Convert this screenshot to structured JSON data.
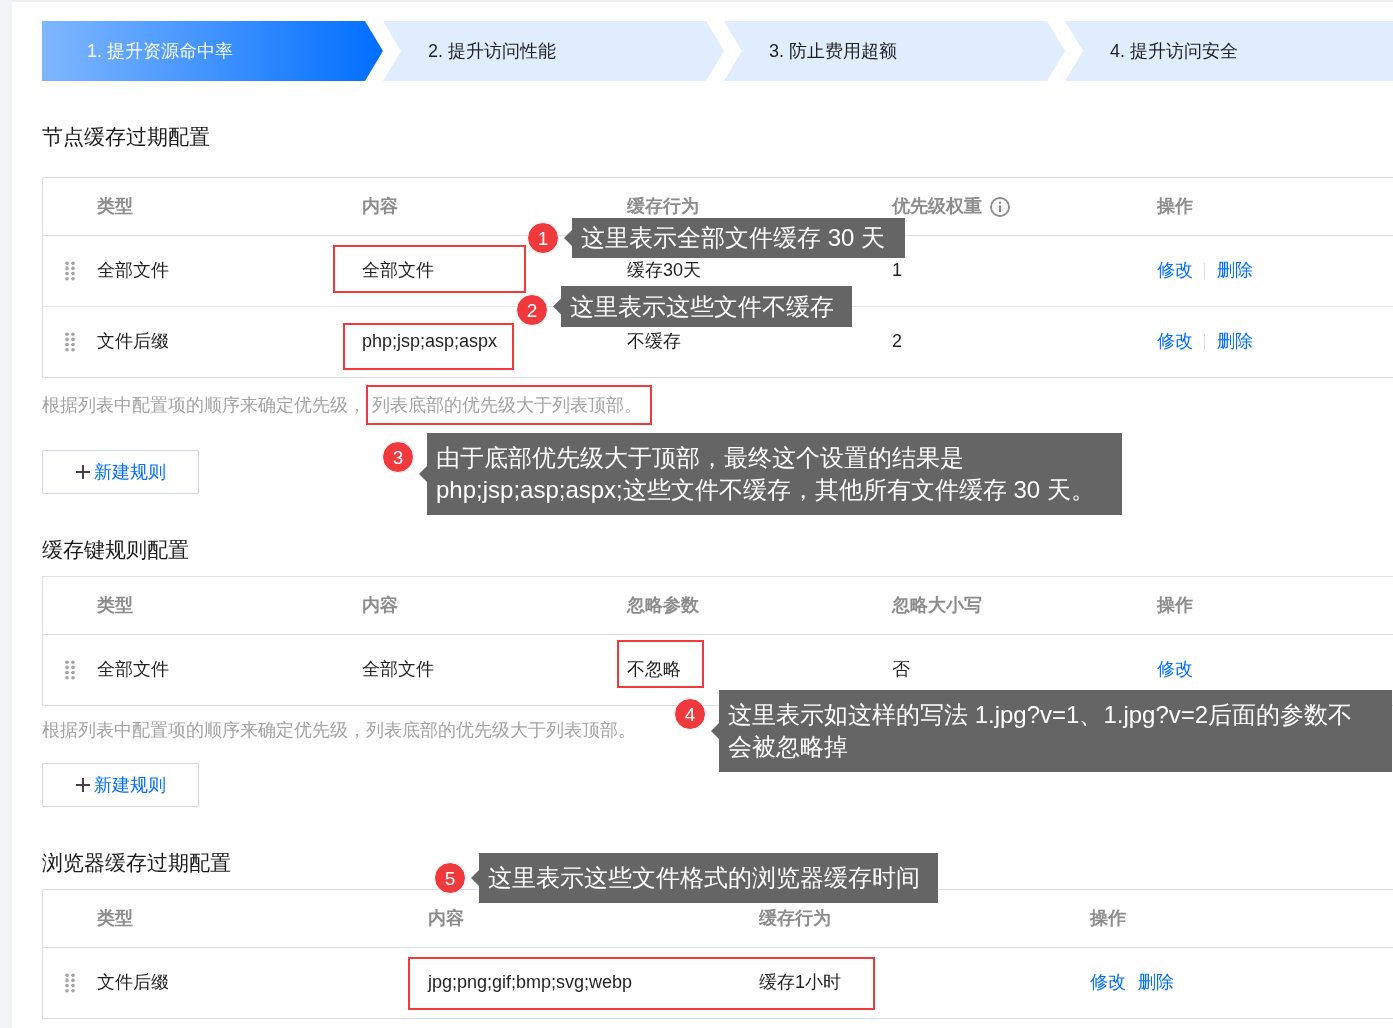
{
  "steps": [
    {
      "label": "1. 提升资源命中率",
      "selected": true
    },
    {
      "label": "2. 提升访问性能",
      "selected": false
    },
    {
      "label": "3. 防止费用超额",
      "selected": false
    },
    {
      "label": "4. 提升访问安全",
      "selected": false
    }
  ],
  "sections": [
    {
      "title": "节点缓存过期配置",
      "table": {
        "columns": [
          {
            "label": "类型",
            "info": false
          },
          {
            "label": "内容",
            "info": false
          },
          {
            "label": "缓存行为",
            "info": false
          },
          {
            "label": "优先级权重",
            "info": true
          },
          {
            "label": "操作",
            "info": false
          }
        ],
        "action_divider": true,
        "rows": [
          {
            "cells": [
              "全部文件",
              "全部文件",
              "缓存30天",
              "1"
            ],
            "actions": [
              "修改",
              "删除"
            ]
          },
          {
            "cells": [
              "文件后缀",
              "php;jsp;asp;aspx",
              "不缓存",
              "2"
            ],
            "actions": [
              "修改",
              "删除"
            ]
          }
        ]
      },
      "note": [
        "根据列表中配置项的顺序来确定优先级，",
        "列表底部的优先级大于列表顶部。"
      ],
      "add_button": "新建规则"
    },
    {
      "title": "缓存键规则配置",
      "table": {
        "columns": [
          {
            "label": "类型",
            "info": false
          },
          {
            "label": "内容",
            "info": false
          },
          {
            "label": "忽略参数",
            "info": false
          },
          {
            "label": "忽略大小写",
            "info": false
          },
          {
            "label": "操作",
            "info": false
          }
        ],
        "rows": [
          {
            "cells": [
              "全部文件",
              "全部文件",
              "不忽略",
              "否"
            ],
            "actions": [
              "修改"
            ]
          }
        ]
      },
      "note": "根据列表中配置项的顺序来确定优先级，列表底部的优先级大于列表顶部。",
      "add_button": "新建规则"
    },
    {
      "title": "浏览器缓存过期配置",
      "table": {
        "columns": [
          {
            "label": "类型",
            "info": false
          },
          {
            "label": "内容",
            "info": false
          },
          {
            "label": "缓存行为",
            "info": false
          },
          {
            "label": "操作",
            "info": false
          }
        ],
        "action_divider": false,
        "rows": [
          {
            "cells": [
              "文件后缀",
              "jpg;png;gif;bmp;svg;webp",
              "缓存1小时"
            ],
            "actions": [
              "修改",
              "删除"
            ]
          }
        ]
      }
    }
  ],
  "annotations": [
    {
      "number": "1",
      "text": "这里表示全部文件缓存 30 天"
    },
    {
      "number": "2",
      "text": "这里表示这些文件不缓存"
    },
    {
      "number": "3",
      "text": "由于底部优先级大于顶部，最终这个设置的结果是\nphp;jsp;asp;aspx;这些文件不缓存，其他所有文件缓存 30 天。"
    },
    {
      "number": "4",
      "text": "这里表示如这样的写法 1.jpg?v=1、1.jpg?v=2后面的参数不会被忽略掉"
    },
    {
      "number": "5",
      "text": "这里表示这些文件格式的浏览器缓存时间"
    }
  ]
}
